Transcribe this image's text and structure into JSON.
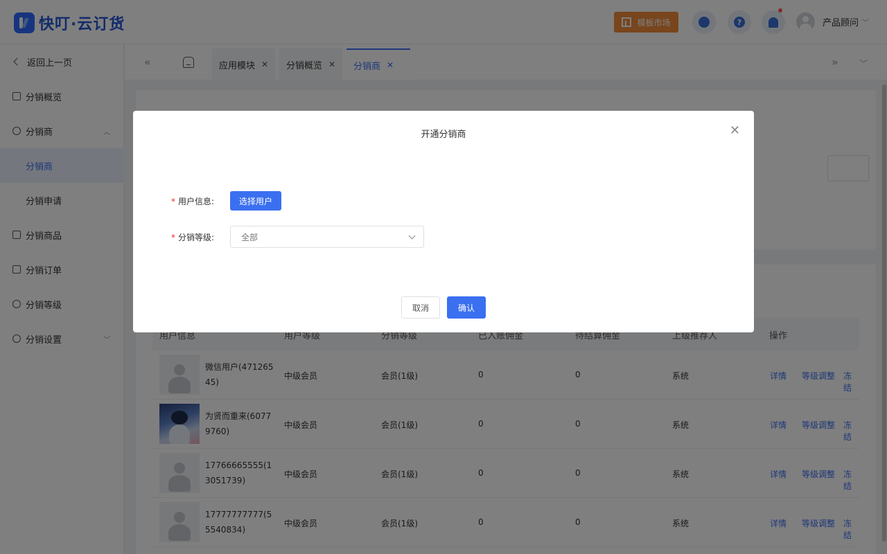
{
  "header": {
    "logo_text": "快叮·云订货",
    "market_label": "模板市场",
    "help_icon_text": "?",
    "user_name": "产品顾问"
  },
  "sidebar": {
    "back_label": "返回上一页",
    "items": [
      {
        "label": "分销概览",
        "icon": "chart-icon"
      },
      {
        "label": "分销商",
        "icon": "users-icon"
      },
      {
        "label": "分销商",
        "sub": true,
        "active": true
      },
      {
        "label": "分销申请",
        "sub": true
      },
      {
        "label": "分销商品",
        "icon": "box-icon"
      },
      {
        "label": "分销订单",
        "icon": "order-icon"
      },
      {
        "label": "分销等级",
        "icon": "level-icon"
      },
      {
        "label": "分销设置",
        "icon": "settings-icon"
      }
    ]
  },
  "tabs": [
    {
      "label": "应用模块"
    },
    {
      "label": "分销概览"
    },
    {
      "label": "分销商",
      "active": true
    }
  ],
  "table": {
    "columns": [
      "用户信息",
      "用户等级",
      "分销等级",
      "已入账佣金",
      "待结算佣金",
      "上级推荐人",
      "操作"
    ],
    "rows": [
      {
        "name": "微信用户(47126545)",
        "user_level": "中级会员",
        "dist_level": "会员(1级)",
        "settled": "0",
        "pending": "0",
        "referrer": "系统"
      },
      {
        "name": "为贤而重来(60779760)",
        "user_level": "中级会员",
        "dist_level": "会员(1级)",
        "settled": "0",
        "pending": "0",
        "referrer": "系统"
      },
      {
        "name": "17766665555(13051739)",
        "user_level": "中级会员",
        "dist_level": "会员(1级)",
        "settled": "0",
        "pending": "0",
        "referrer": "系统"
      },
      {
        "name": "17777777777(55540834)",
        "user_level": "中级会员",
        "dist_level": "会员(1级)",
        "settled": "0",
        "pending": "0",
        "referrer": "系统"
      }
    ],
    "actions": {
      "detail": "详情",
      "adjust": "等级调整",
      "freeze": "冻结"
    }
  },
  "modal": {
    "title": "开通分销商",
    "user_info_label": "用户信息:",
    "select_user_button": "选择用户",
    "level_label": "分销等级:",
    "level_value": "全部",
    "required_mark": "*",
    "cancel_label": "取消",
    "confirm_label": "确认"
  }
}
